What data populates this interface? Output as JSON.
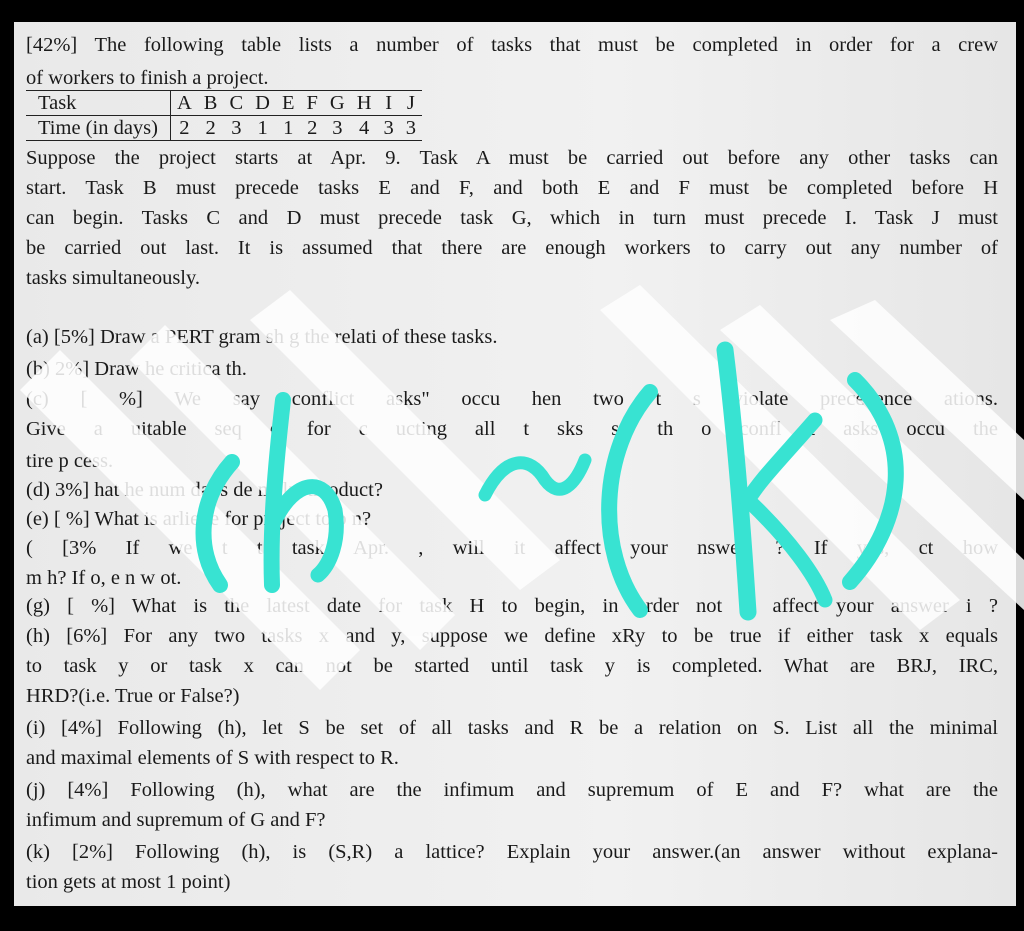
{
  "intro": {
    "line1": "[42%] The following table lists a number of tasks that must be completed in order for a crew",
    "line2": "of workers to finish a project."
  },
  "table": {
    "row_headers": [
      "Task",
      "Time (in days)"
    ],
    "tasks": [
      "A",
      "B",
      "C",
      "D",
      "E",
      "F",
      "G",
      "H",
      "I",
      "J"
    ],
    "times": [
      "2",
      "2",
      "3",
      "1",
      "1",
      "2",
      "3",
      "4",
      "3",
      "3"
    ]
  },
  "paragraph": [
    "Suppose the project starts at Apr. 9. Task A must be carried out before any other tasks can",
    "start. Task B must precede tasks E and F, and both E and F must be completed before H",
    "can begin. Tasks C and D must precede task G, which in turn must precede I. Task J must",
    "be carried out last. It is assumed that there are enough workers to carry out any number of",
    "tasks simultaneously."
  ],
  "questions": [
    "(a) [5%] Draw a PERT      gram sh      g the relati      of these tasks.",
    "(b)  2%] Draw  he critica    th.",
    "(c) [  %] We say   conflict     asks\" occu     hen two t     s violate        precedence   ations.",
    "Give a  uitable seq     e for c    ucting all t     sks so th     o confl  t     asks occu     the",
    "  tire p   cess.",
    "(d)  3%]   hat    he        num       days   de     make th     oduct?",
    "(e) [  %] What is      arlie    te for     project to b      n?",
    "(  [3%  If we       t t     task      Apr.  , will it affect your  nswer      ? If yes,       ct how",
    "m   h? If  o, e     n w     ot.",
    "(g) [ %] What is the latest date for task H to begin, in order not to affect your answer i       ?",
    "(h) [6%] For any two tasks x and y, suppose we define xRy to be true if either task x equals",
    "to task y or task x can not be started until task y is completed. What are BRJ, IRC,",
    "HRD?(i.e. True or False?)",
    "(i) [4%] Following (h), let S be set of all tasks and R be a relation on S. List all the minimal",
    "and maximal elements of S with respect to R.",
    "(j) [4%] Following (h), what are the infimum and supremum of E and F? what are the",
    "infimum and supremum of G and F?",
    "(k) [2%] Following (h), is (S,R) a lattice? Explain your answer.(an answer without explana-",
    "tion gets at most 1 point)"
  ],
  "watermark": {
    "handwriting": "(h)~(k)",
    "ink_color": "#38e3d2",
    "stripe_color": "#ffffff"
  }
}
